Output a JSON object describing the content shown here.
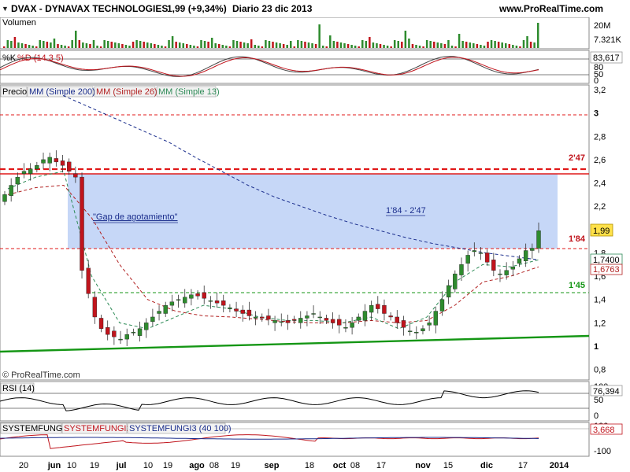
{
  "header": {
    "symbol_line": "DVAX - DYNAVAX TECHNOLOGIES",
    "price_line": "1,99 (+9,34%)",
    "period_line": "Diario  23 dic 2013",
    "site": "www.ProRealTime.com"
  },
  "panels": {
    "volume": {
      "label": "Volumen",
      "axis_labels": [
        "20M",
        "7.321K"
      ]
    },
    "stoch": {
      "label_k": "%K",
      "label_d": "%D (14 3 5)",
      "axis_labels": [
        "83,617",
        "80",
        "50",
        "0"
      ]
    },
    "price": {
      "labels": [
        "Precio",
        "MM (Simple 200)",
        "MM (Simple 26)",
        "MM (Simple 13)"
      ],
      "axis_labels": [
        "3,2",
        "3",
        "2,8",
        "2,6",
        "2,4",
        "2,2",
        "2",
        "1,8",
        "1,6",
        "1,4",
        "1,2",
        "1",
        "0,8"
      ],
      "price_tag": "1,99",
      "ma_tag_1": "1,7400",
      "ma_tag_2": "1,6763",
      "annotation_gap": "\"Gap de agotamiento\"",
      "annotation_range": "1'84 - 2'47",
      "level_247": "2'47",
      "level_184": "1'84",
      "level_145": "1'45",
      "copyright": "© ProRealTime.com"
    },
    "rsi": {
      "label": "RSI (14)",
      "axis_labels": [
        "100",
        "76,394",
        "50",
        "0"
      ]
    },
    "fungi": {
      "label_1": "SYSTEMFUNGI",
      "label_2": "SYSTEMFUNGI2",
      "label_3": "SYSTEMFUNGI3 (40 100)",
      "axis_labels": [
        "100",
        "3,668",
        "-100"
      ]
    }
  },
  "x_axis": {
    "labels": [
      "20",
      "jun",
      "10",
      "19",
      "jul",
      "10",
      "19",
      "ago",
      "08",
      "19",
      "sep",
      "18",
      "oct",
      "08",
      "17",
      "nov",
      "15",
      "dic",
      "17",
      "2014"
    ]
  },
  "colors": {
    "bull": "#2e8b2e",
    "bear": "#c0141c",
    "gap_fill": "#c6d7f7",
    "ma200": "#1a2d8c",
    "ma26": "#b22222",
    "ma13": "#2e8b57",
    "support": "#149614",
    "resistance": "#e01818"
  },
  "chart_data": {
    "type": "candlestick",
    "title": "DVAX - DYNAVAX TECHNOLOGIES",
    "x_labels": [
      "20",
      "jun",
      "10",
      "19",
      "jul",
      "10",
      "19",
      "ago",
      "08",
      "19",
      "sep",
      "18",
      "oct",
      "08",
      "17",
      "nov",
      "15",
      "dic",
      "17",
      "2014"
    ],
    "ylim": [
      0.7,
      3.3
    ],
    "close_series": [
      2.3,
      2.38,
      2.45,
      2.5,
      2.52,
      2.55,
      2.6,
      2.62,
      2.58,
      2.55,
      2.5,
      2.45,
      1.65,
      1.45,
      1.25,
      1.15,
      1.1,
      1.08,
      1.06,
      1.1,
      1.12,
      1.15,
      1.2,
      1.25,
      1.3,
      1.35,
      1.38,
      1.4,
      1.42,
      1.44,
      1.43,
      1.41,
      1.39,
      1.37,
      1.35,
      1.33,
      1.3,
      1.28,
      1.26,
      1.25,
      1.24,
      1.23,
      1.22,
      1.21,
      1.2,
      1.22,
      1.24,
      1.26,
      1.28,
      1.25,
      1.22,
      1.2,
      1.18,
      1.16,
      1.2,
      1.25,
      1.3,
      1.35,
      1.32,
      1.28,
      1.25,
      1.2,
      1.16,
      1.13,
      1.12,
      1.15,
      1.2,
      1.3,
      1.4,
      1.52,
      1.62,
      1.7,
      1.78,
      1.82,
      1.8,
      1.72,
      1.65,
      1.62,
      1.65,
      1.68,
      1.75,
      1.82,
      1.84,
      1.99
    ],
    "series": [
      {
        "name": "MM (Simple 200)",
        "values": [
          3.15,
          3.05,
          2.95,
          2.85,
          2.75,
          2.62,
          2.5,
          2.38,
          2.28,
          2.2,
          2.12,
          2.05,
          1.99,
          1.93,
          1.88,
          1.84,
          1.8,
          1.77,
          1.74
        ]
      },
      {
        "name": "MM (Simple 26)",
        "values": [
          2.3,
          2.36,
          2.38,
          2.1,
          1.7,
          1.4,
          1.3,
          1.26,
          1.25,
          1.23,
          1.21,
          1.2,
          1.2,
          1.22,
          1.2,
          1.22,
          1.35,
          1.55,
          1.6,
          1.68
        ]
      },
      {
        "name": "MM (Simple 13)",
        "values": [
          2.35,
          2.45,
          2.5,
          1.6,
          1.2,
          1.15,
          1.25,
          1.35,
          1.32,
          1.25,
          1.22,
          1.22,
          1.2,
          1.25,
          1.15,
          1.25,
          1.55,
          1.7,
          1.68,
          1.74
        ]
      }
    ],
    "levels": {
      "resistance": 2.47,
      "gap_low": 1.84,
      "support_145": 1.45
    },
    "volume_ylim": [
      0,
      20
    ],
    "rsi_last": 76.394,
    "stoch_last": 83.617,
    "fungi_last": 3.668
  }
}
